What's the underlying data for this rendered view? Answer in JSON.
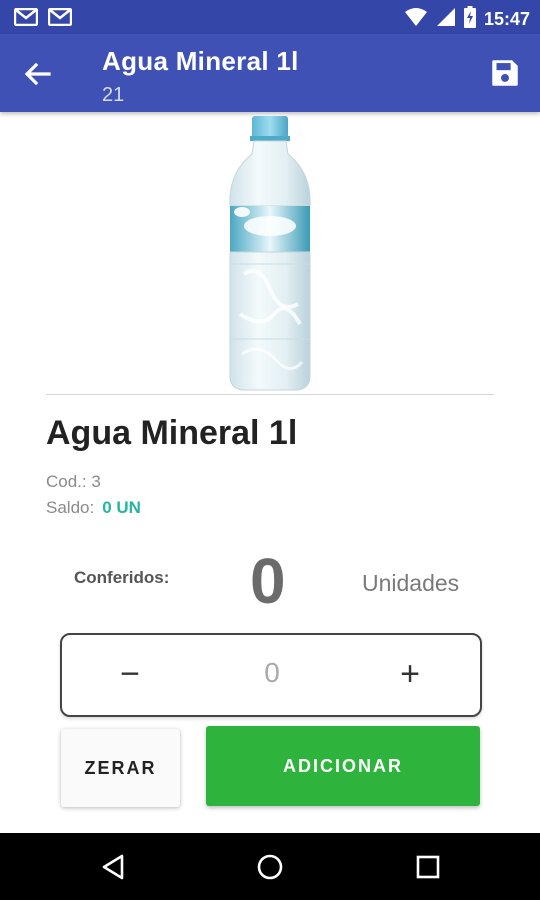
{
  "status_bar": {
    "time": "15:47",
    "icons": [
      "gmail-icon",
      "gmail-icon",
      "wifi-icon",
      "signal-icon",
      "battery-charging-icon"
    ]
  },
  "app_bar": {
    "title": "Agua Mineral 1l",
    "subtitle": "21",
    "back_icon": "arrow-back-icon",
    "save_icon": "save-icon",
    "color": "#3f51b5"
  },
  "product": {
    "name": "Agua Mineral 1l",
    "cod_label": "Cod.: 3",
    "saldo_label": "Saldo:",
    "saldo_value": "0 UN",
    "saldo_color": "#26b4a3"
  },
  "counter": {
    "label": "Conferidos:",
    "value": "0",
    "unit": "Unidades"
  },
  "stepper": {
    "minus_label": "−",
    "value": "0",
    "plus_label": "+"
  },
  "buttons": {
    "zerar": "ZERAR",
    "adicionar": "ADICIONAR",
    "adicionar_color": "#2eb43d"
  },
  "nav_bar": {
    "icons": [
      "nav-back-icon",
      "nav-home-icon",
      "nav-recents-icon"
    ]
  }
}
